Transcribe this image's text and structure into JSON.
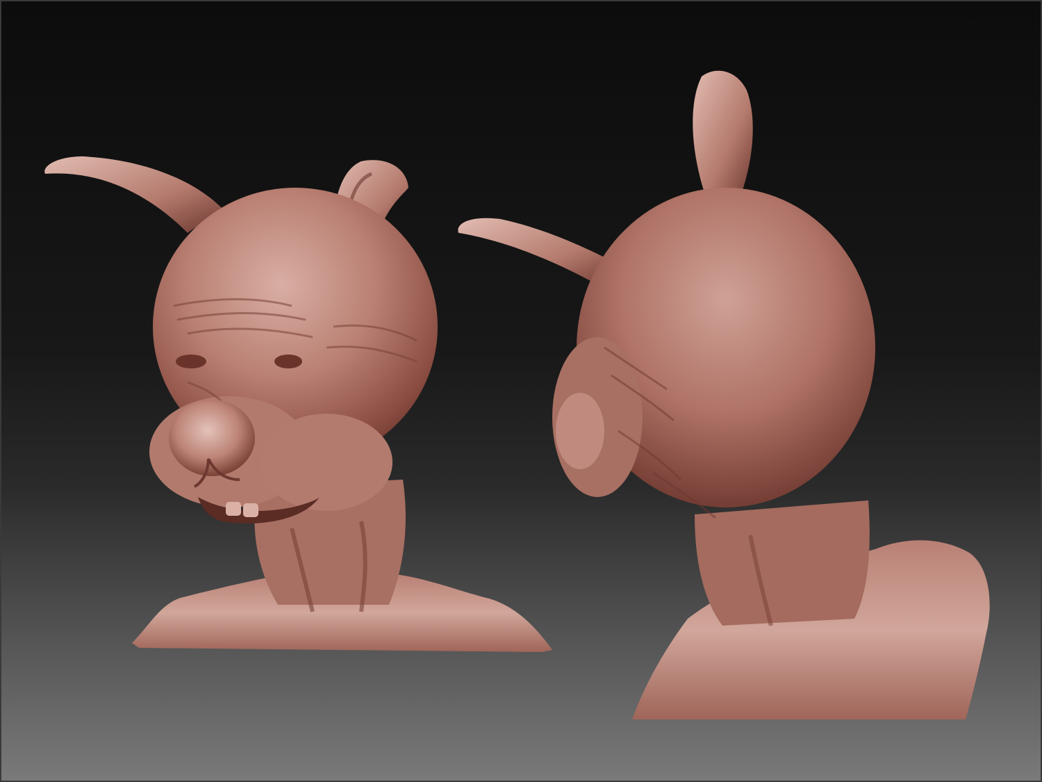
{
  "scene": {
    "subject": "",
    "views": [
      {
        "id": "front-three-quarter"
      },
      {
        "id": "back-three-quarter"
      }
    ]
  },
  "colors": {
    "background_top": "#0c0c0c",
    "background_bottom": "#7a7a7a",
    "clay_light": "#d9aea4",
    "clay_mid": "#a86f63",
    "clay_dark": "#5a2c24"
  }
}
